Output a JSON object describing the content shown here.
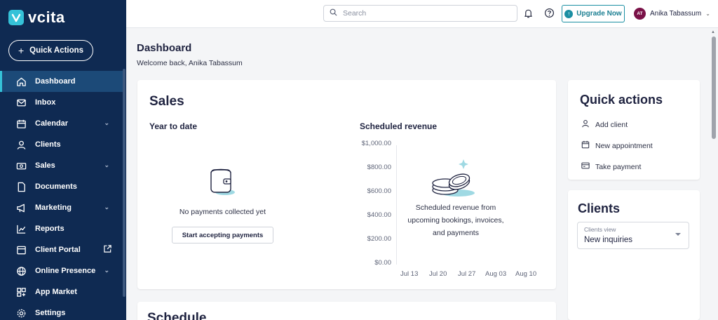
{
  "brand": {
    "name": "vcita"
  },
  "sidebar": {
    "quick_actions_label": "Quick Actions",
    "items": [
      {
        "label": "Dashboard"
      },
      {
        "label": "Inbox"
      },
      {
        "label": "Calendar"
      },
      {
        "label": "Clients"
      },
      {
        "label": "Sales"
      },
      {
        "label": "Documents"
      },
      {
        "label": "Marketing"
      },
      {
        "label": "Reports"
      },
      {
        "label": "Client Portal"
      },
      {
        "label": "Online Presence"
      },
      {
        "label": "App Market"
      },
      {
        "label": "Settings"
      }
    ]
  },
  "topbar": {
    "search_placeholder": "Search",
    "upgrade_label": "Upgrade Now",
    "user_initials": "AT",
    "user_name": "Anika Tabassum"
  },
  "page": {
    "title": "Dashboard",
    "subtitle": "Welcome back, Anika Tabassum"
  },
  "sales": {
    "title": "Sales",
    "ytd_title": "Year to date",
    "no_payments": "No payments collected yet",
    "start_button": "Start accepting payments",
    "scheduled_title": "Scheduled revenue",
    "y_ticks": [
      "$1,000.00",
      "$800.00",
      "$600.00",
      "$400.00",
      "$200.00",
      "$0.00"
    ],
    "x_ticks": [
      "Jul 13",
      "Jul 20",
      "Jul 27",
      "Aug 03",
      "Aug 10"
    ],
    "empty_msg": "Scheduled revenue from upcoming bookings, invoices, and payments"
  },
  "quick_actions": {
    "title": "Quick actions",
    "items": [
      {
        "label": "Add client",
        "icon": "person-icon"
      },
      {
        "label": "New appointment",
        "icon": "calendar-icon"
      },
      {
        "label": "Take payment",
        "icon": "payment-icon"
      }
    ]
  },
  "clients": {
    "title": "Clients",
    "view_label": "Clients view",
    "view_value": "New inquiries"
  },
  "schedule": {
    "title": "Schedule"
  },
  "colors": {
    "sidebar_bg": "#0f2a52",
    "accent": "#35c2d8",
    "upgrade": "#1b8fa3"
  }
}
